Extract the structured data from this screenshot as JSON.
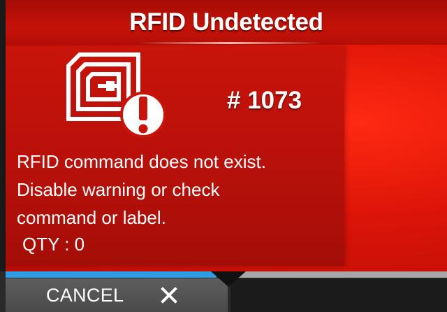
{
  "dialog": {
    "title": "RFID Undetected",
    "error_code": "# 1073",
    "message_lines": [
      "RFID command does not exist.",
      "Disable warning or check",
      "command or label."
    ],
    "qty": "QTY : 0",
    "icon": "rfid-tag-warning-icon"
  },
  "footer": {
    "cancel_label": "CANCEL",
    "cancel_icon": "close-icon"
  },
  "colors": {
    "error_red": "#c8140a",
    "title_red": "#a60c06",
    "progress_blue": "#2d9de6",
    "progress_grey": "#a6a6a6",
    "button_grey": "#545454",
    "text": "#ffffff"
  }
}
